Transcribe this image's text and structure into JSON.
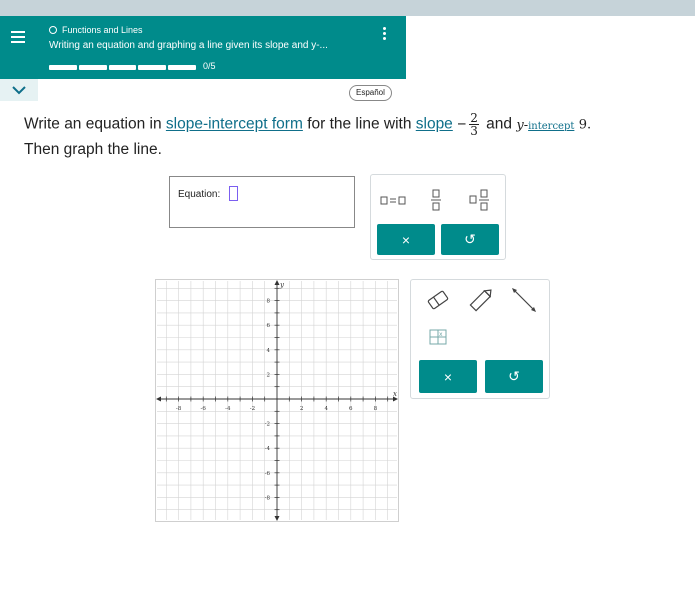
{
  "header": {
    "topic": "Functions and Lines",
    "title": "Writing an equation and graphing a line given its slope and y-...",
    "progress_text": "0/5",
    "progress_segments": 5,
    "progress_completed": 0
  },
  "language_button": "Español",
  "problem": {
    "lead": "Write an equation in",
    "link1": "slope-intercept form",
    "mid": "for the line with",
    "link2": "slope",
    "slope_sign": "−",
    "slope_num": "2",
    "slope_den": "3",
    "and_text": "and",
    "y_var": "y",
    "link3": "intercept",
    "intercept_value": "9.",
    "line2": "Then graph the line."
  },
  "equation": {
    "label": "Equation:"
  },
  "toolbar": {
    "clear_symbol": "×",
    "undo_symbol": "↺"
  },
  "graph": {
    "x_label": "x",
    "y_label": "y",
    "x_ticks": [
      "-8",
      "-6",
      "-4",
      "-2",
      "2",
      "4",
      "6",
      "8"
    ],
    "y_ticks_pos": [
      "8",
      "6",
      "4",
      "2"
    ],
    "y_ticks_neg": [
      "-2",
      "-4",
      "-6",
      "-8"
    ]
  },
  "graph_toolbar": {
    "clear_symbol": "×",
    "undo_symbol": "↺"
  },
  "colors": {
    "teal": "#008b8b",
    "link": "#0f6f8a",
    "input_border": "#7b5ef0"
  }
}
